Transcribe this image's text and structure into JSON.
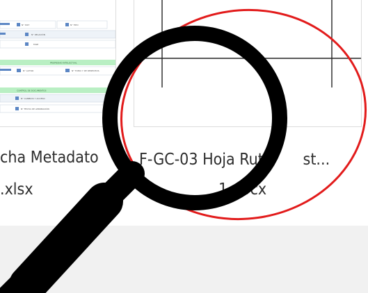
{
  "files": [
    {
      "name_line1": "cha Metadato",
      "name_line2": ".xlsx",
      "thumbnail": "spreadsheet-preview",
      "preview_text": {
        "row1": "N° SIST",
        "row1b": "N° TIPO",
        "row2": "N° RELACIÓN",
        "row3": "FASE",
        "band1": "PROPIEDAD INTELECTUAL",
        "row4a": "N° AUTOR",
        "row4b": "N° TOMO Y DE DERECHOS",
        "band2": "CONTROL DE DOCUMENTOS",
        "row5": "N° CAMBIOS Y ACCESO",
        "row6": "N° FECHA DE APROBACIÓN"
      }
    },
    {
      "name_line1": "F-GC-03 Hoja Ruta",
      "name_line1_tail": "st...",
      "name_line2": "1.docx",
      "thumbnail": "document-preview"
    }
  ],
  "colors": {
    "annotation_circle": "#e21b1b",
    "magnifier": "#000000",
    "sheet_band": "#b9efc3",
    "sheet_cell": "#cfe0ec",
    "sheet_tag": "#5b86c4",
    "bottom_band": "#f1f1f1"
  },
  "overlay_icons": [
    "magnifier-icon",
    "annotation-circle"
  ]
}
